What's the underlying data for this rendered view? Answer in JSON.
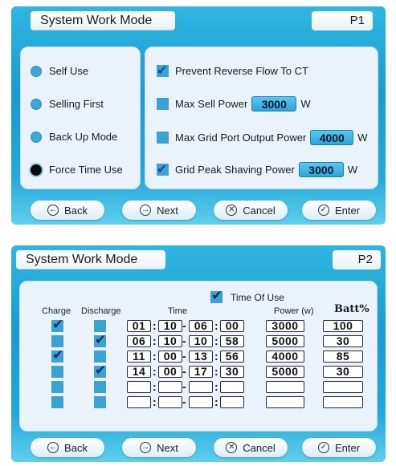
{
  "page1": {
    "title": "System Work Mode",
    "page_label": "P1",
    "modes": [
      {
        "label": "Self Use",
        "selected": false
      },
      {
        "label": "Selling First",
        "selected": false
      },
      {
        "label": "Back Up Mode",
        "selected": false
      },
      {
        "label": "Force Time Use",
        "selected": true
      }
    ],
    "options": [
      {
        "label": "Prevent Reverse Flow To CT",
        "checked": true,
        "value": "",
        "unit": ""
      },
      {
        "label": "Max Sell Power",
        "checked": false,
        "value": "3000",
        "unit": "W"
      },
      {
        "label": "Max Grid Port Output Power",
        "checked": false,
        "value": "4000",
        "unit": "W"
      },
      {
        "label": "Grid Peak Shaving Power",
        "checked": true,
        "value": "3000",
        "unit": "W"
      }
    ],
    "buttons": {
      "back": "Back",
      "next": "Next",
      "cancel": "Cancel",
      "enter": "Enter"
    }
  },
  "page2": {
    "title": "System Work Mode",
    "page_label": "P2",
    "time_of_use_label": "Time Of Use",
    "time_of_use_checked": true,
    "headers": {
      "charge": "Charge",
      "discharge": "Discharge",
      "time": "Time",
      "power": "Power (w)",
      "batt": "Batt%"
    },
    "time_sep_colon": ":",
    "time_sep_dash": "-",
    "rows": [
      {
        "charge": true,
        "discharge": false,
        "start_h": "01",
        "start_m": "10",
        "end_h": "06",
        "end_m": "00",
        "power": "3000",
        "batt": "100"
      },
      {
        "charge": false,
        "discharge": true,
        "start_h": "06",
        "start_m": "10",
        "end_h": "10",
        "end_m": "58",
        "power": "5000",
        "batt": "30"
      },
      {
        "charge": true,
        "discharge": false,
        "start_h": "11",
        "start_m": "00",
        "end_h": "13",
        "end_m": "56",
        "power": "4000",
        "batt": "85"
      },
      {
        "charge": false,
        "discharge": true,
        "start_h": "14",
        "start_m": "00",
        "end_h": "17",
        "end_m": "30",
        "power": "5000",
        "batt": "30"
      },
      {
        "charge": false,
        "discharge": false,
        "start_h": "",
        "start_m": "",
        "end_h": "",
        "end_m": "",
        "power": "",
        "batt": ""
      },
      {
        "charge": false,
        "discharge": false,
        "start_h": "",
        "start_m": "",
        "end_h": "",
        "end_m": "",
        "power": "",
        "batt": ""
      }
    ],
    "buttons": {
      "back": "Back",
      "next": "Next",
      "cancel": "Cancel",
      "enter": "Enter"
    }
  },
  "icons": {
    "back": "arrow-left-circle-icon",
    "next": "arrow-right-circle-icon",
    "cancel": "x-circle-icon",
    "enter": "check-circle-icon"
  },
  "colors": {
    "accent": "#1a9bd0",
    "panel": "#eaf3fb",
    "checkbox": "#3aa3d3",
    "selected_radio": "#0a0a0a"
  }
}
